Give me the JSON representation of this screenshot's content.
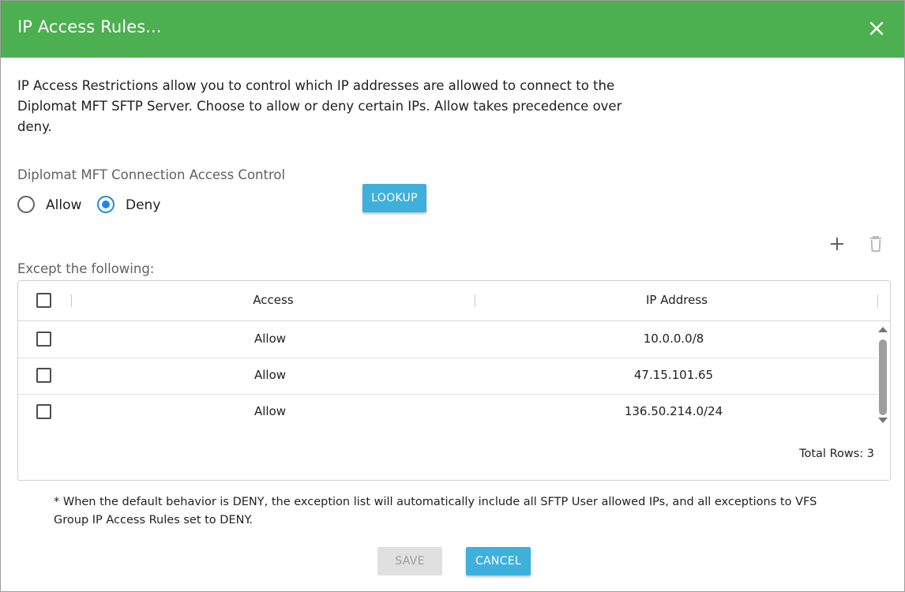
{
  "dialog": {
    "title": "IP Access Rules...",
    "description": "IP Access Restrictions allow you to control which IP addresses are allowed to connect to the Diplomat MFT SFTP Server. Choose to allow or deny certain IPs. Allow takes precedence over deny.",
    "access_control_label": "Diplomat MFT Connection Access Control",
    "radio": {
      "allow_label": "Allow",
      "deny_label": "Deny",
      "selected": "Deny"
    },
    "lookup_label": "LOOKUP",
    "except_label": "Except the following:",
    "toolbar": {
      "add_icon": "plus-icon",
      "delete_icon": "trash-icon"
    },
    "grid": {
      "columns": [
        "Access",
        "IP Address"
      ],
      "rows": [
        {
          "access": "Allow",
          "ip": "10.0.0.0/8"
        },
        {
          "access": "Allow",
          "ip": "47.15.101.65"
        },
        {
          "access": "Allow",
          "ip": "136.50.214.0/24"
        }
      ],
      "total_rows": "Total Rows: 3"
    },
    "footnote": "* When the default behavior is DENY, the exception list will automatically include all SFTP User allowed IPs, and all exceptions to VFS Group IP Access Rules set to DENY.",
    "buttons": {
      "save": "SAVE",
      "cancel": "CANCEL"
    },
    "colors": {
      "header": "#4caf50",
      "primary_button": "#3eb0db",
      "radio_selected": "#1e88e5"
    }
  }
}
